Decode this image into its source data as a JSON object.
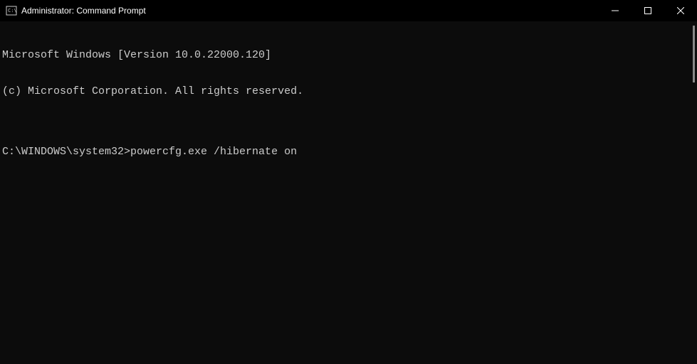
{
  "titlebar": {
    "title": "Administrator: Command Prompt"
  },
  "console": {
    "line1": "Microsoft Windows [Version 10.0.22000.120]",
    "line2": "(c) Microsoft Corporation. All rights reserved.",
    "blank1": "",
    "prompt": "C:\\WINDOWS\\system32>",
    "command": "powercfg.exe /hibernate on"
  }
}
